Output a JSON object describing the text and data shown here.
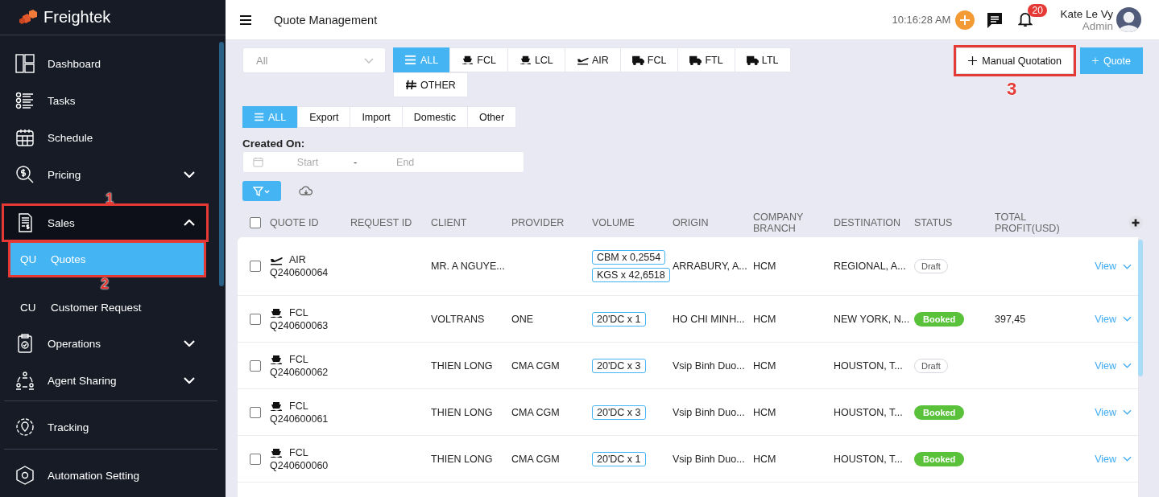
{
  "brand": {
    "name": "Freightek"
  },
  "sidebar": {
    "sections": [
      [
        {
          "label": "Dashboard"
        },
        {
          "label": "Tasks"
        },
        {
          "label": "Schedule"
        },
        {
          "label": "Pricing",
          "expanded": false
        },
        {
          "label": "Sales",
          "expanded": true,
          "annotation": "1",
          "children": [
            {
              "abbr": "QU",
              "label": "Quotes",
              "selected": true,
              "annotation": "2"
            },
            {
              "abbr": "CU",
              "label": "Customer Request",
              "selected": false
            }
          ]
        },
        {
          "label": "Operations",
          "expanded": false
        },
        {
          "label": "Agent Sharing",
          "expanded": false
        }
      ],
      [
        {
          "label": "Tracking"
        }
      ],
      [
        {
          "label": "Automation Setting"
        }
      ]
    ]
  },
  "header": {
    "title": "Quote Management",
    "time": "10:16:28 AM",
    "notification_count": "20",
    "user_name": "Kate Le Vy",
    "user_role": "Admin"
  },
  "filters": {
    "dropdown": {
      "value": "All"
    },
    "modes": [
      {
        "label": "ALL",
        "kind": "list",
        "selected": true
      },
      {
        "label": "FCL",
        "kind": "ship",
        "selected": false
      },
      {
        "label": "LCL",
        "kind": "ship",
        "selected": false
      },
      {
        "label": "AIR",
        "kind": "plane",
        "selected": false
      },
      {
        "label": "FCL",
        "kind": "truck",
        "selected": false
      },
      {
        "label": "FTL",
        "kind": "truck",
        "selected": false
      },
      {
        "label": "LTL",
        "kind": "truck",
        "selected": false
      },
      {
        "label": "OTHER",
        "kind": "hash",
        "selected": false
      }
    ],
    "directions": [
      {
        "label": "ALL",
        "kind": "list",
        "selected": true
      },
      {
        "label": "Export",
        "selected": false
      },
      {
        "label": "Import",
        "selected": false
      },
      {
        "label": "Domestic",
        "selected": false
      },
      {
        "label": "Other",
        "selected": false
      }
    ],
    "created_on": {
      "label": "Created On:",
      "start_placeholder": "Start",
      "separator": "-",
      "end_placeholder": "End"
    }
  },
  "actions": [
    {
      "label": "Manual Quotation",
      "kind": "outline",
      "annotation": "3"
    },
    {
      "label": "Quote",
      "kind": "primary"
    }
  ],
  "table": {
    "all_checked": false,
    "columns": [
      "QUOTE ID",
      "REQUEST ID",
      "CLIENT",
      "PROVIDER",
      "VOLUME",
      "ORIGIN",
      "COMPANY BRANCH",
      "DESTINATION",
      "STATUS",
      "TOTAL PROFIT(USD)"
    ],
    "rows": [
      {
        "mode": "AIR",
        "kind": "plane",
        "quote_id": "Q240600064",
        "client": "MR. A NGUYE...",
        "volume": [
          "CBM x 0,2554",
          "KGS x 42,6518"
        ],
        "origin": "ARRABURY, A...",
        "branch": "HCM",
        "destination": "REGIONAL, A...",
        "status": {
          "label": "Draft",
          "kind": "draft"
        },
        "action": "View",
        "checked": false
      },
      {
        "mode": "FCL",
        "kind": "ship",
        "quote_id": "Q240600063",
        "client": "VOLTRANS",
        "provider": "ONE",
        "volume": [
          "20'DC x 1"
        ],
        "origin": "HO CHI MINH...",
        "branch": "HCM",
        "destination": "NEW YORK, N...",
        "status": {
          "label": "Booked",
          "kind": "booked"
        },
        "profit": "397,45",
        "action": "View",
        "checked": false
      },
      {
        "mode": "FCL",
        "kind": "ship",
        "quote_id": "Q240600062",
        "client": "THIEN LONG",
        "provider": "CMA CGM",
        "volume": [
          "20'DC x 3"
        ],
        "origin": "Vsip Binh Duo...",
        "branch": "HCM",
        "destination": "HOUSTON, T...",
        "status": {
          "label": "Draft",
          "kind": "draft"
        },
        "action": "View",
        "checked": false
      },
      {
        "mode": "FCL",
        "kind": "ship",
        "quote_id": "Q240600061",
        "client": "THIEN LONG",
        "provider": "CMA CGM",
        "volume": [
          "20'DC x 3"
        ],
        "origin": "Vsip Binh Duo...",
        "branch": "HCM",
        "destination": "HOUSTON, T...",
        "status": {
          "label": "Booked",
          "kind": "booked"
        },
        "action": "View",
        "checked": false
      },
      {
        "mode": "FCL",
        "kind": "ship",
        "quote_id": "Q240600060",
        "client": "THIEN LONG",
        "provider": "CMA CGM",
        "volume": [
          "20'DC x 1"
        ],
        "origin": "Vsip Binh Duo...",
        "branch": "HCM",
        "destination": "HOUSTON, T...",
        "status": {
          "label": "Booked",
          "kind": "booked"
        },
        "action": "View",
        "checked": false
      }
    ]
  }
}
